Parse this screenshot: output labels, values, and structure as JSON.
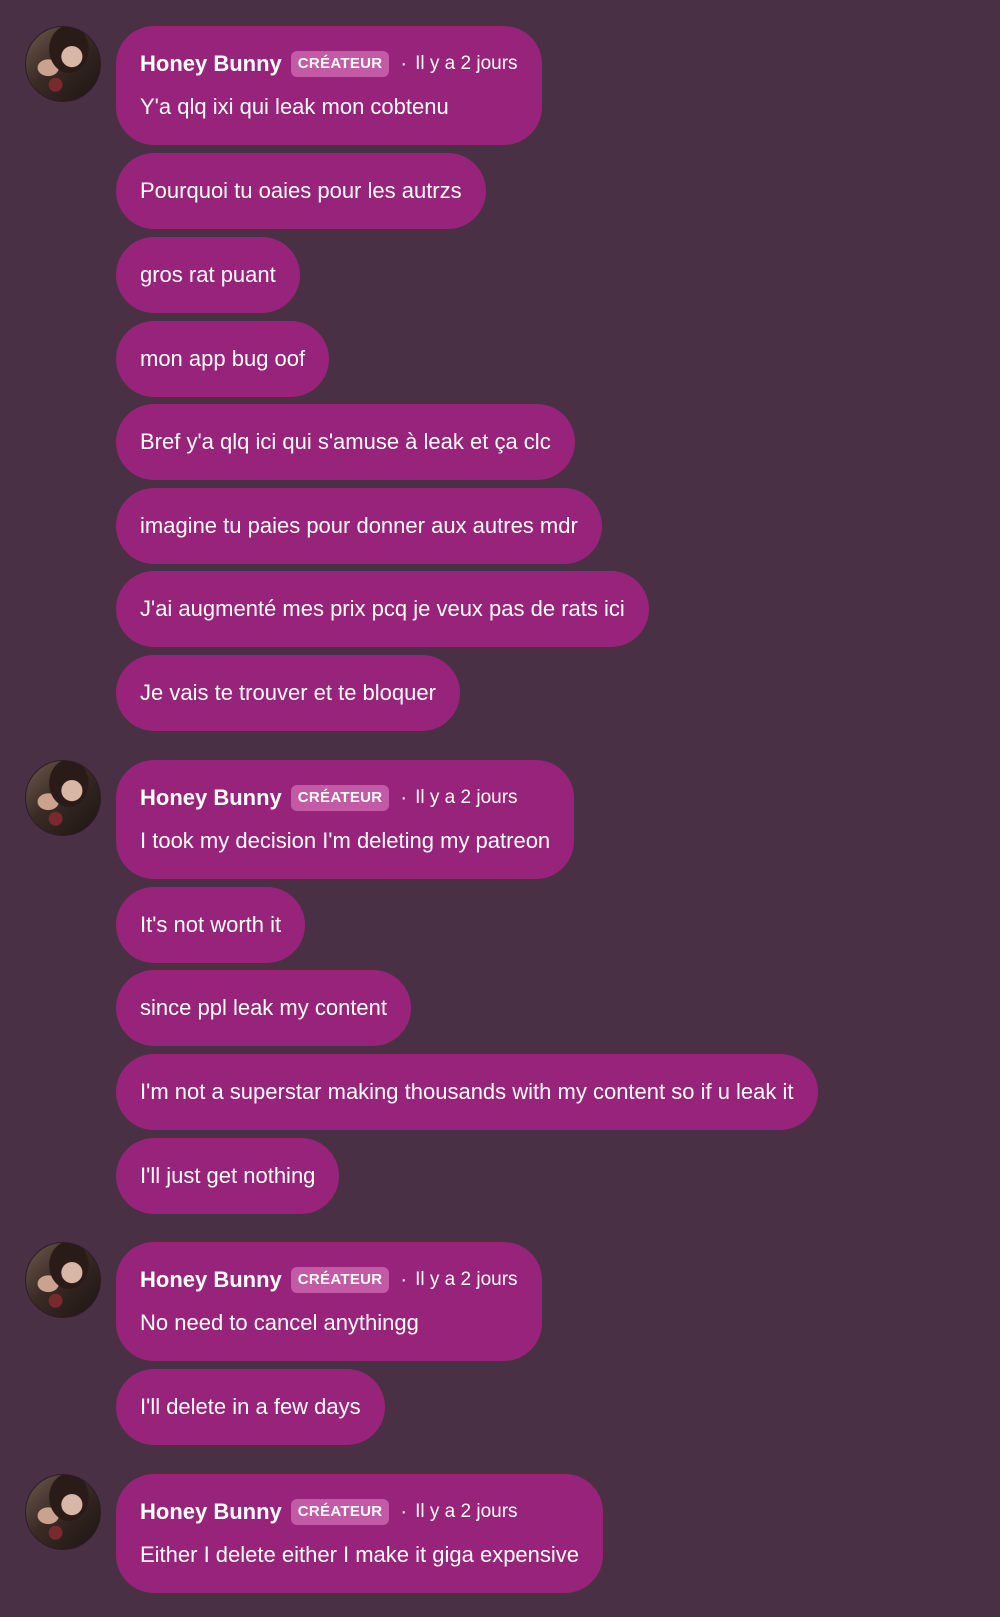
{
  "colors": {
    "background": "#4a3044",
    "bubble": "#98237a",
    "badge": "#c25aa6",
    "text": "#ffffff"
  },
  "groups": [
    {
      "author": "Honey Bunny",
      "badge": "CRÉATEUR",
      "separator": "·",
      "time": "Il y a 2 jours",
      "messages": [
        "Y'a qlq ixi qui leak mon cobtenu",
        "Pourquoi tu oaies pour les autrzs",
        "gros rat puant",
        "mon app bug oof",
        "Bref y'a qlq ici qui s'amuse à leak et ça clc",
        "imagine tu paies pour donner aux autres mdr",
        "J'ai augmenté mes prix pcq je veux pas de rats ici",
        "Je vais te trouver et te bloquer"
      ]
    },
    {
      "author": "Honey Bunny",
      "badge": "CRÉATEUR",
      "separator": "·",
      "time": "Il y a 2 jours",
      "messages": [
        "I took my decision I'm deleting my patreon",
        "It's not worth it",
        "since ppl leak my content",
        "I'm not a superstar making thousands with my content so if u leak it",
        "I'll just get nothing"
      ]
    },
    {
      "author": "Honey Bunny",
      "badge": "CRÉATEUR",
      "separator": "·",
      "time": "Il y a 2 jours",
      "messages": [
        "No need to cancel anythingg",
        "I'll delete in a few days"
      ]
    },
    {
      "author": "Honey Bunny",
      "badge": "CRÉATEUR",
      "separator": "·",
      "time": "Il y a 2 jours",
      "messages": [
        "Either I delete either I make it giga expensive"
      ]
    }
  ]
}
